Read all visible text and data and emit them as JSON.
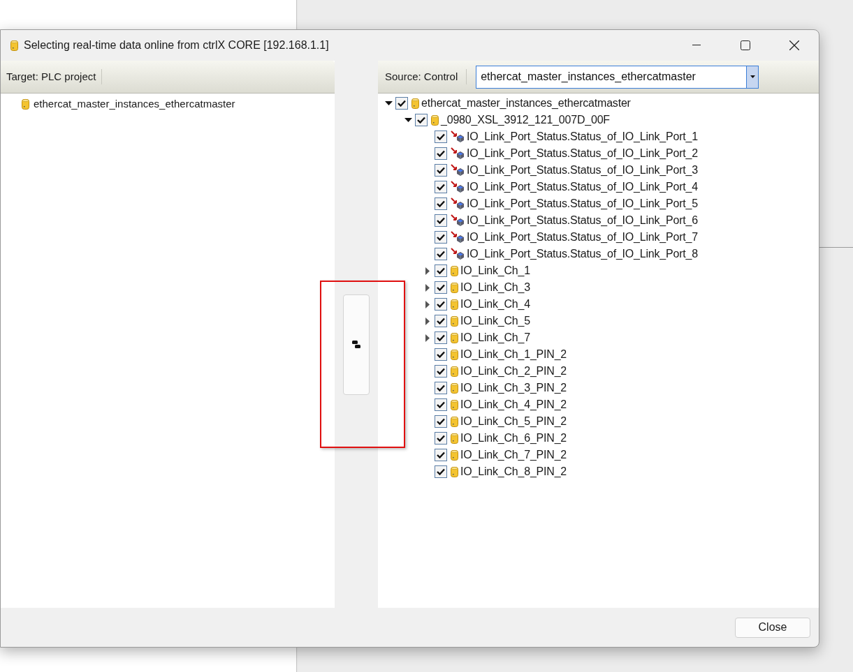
{
  "window": {
    "title": "Selecting real-time data online from ctrlX CORE [192.168.1.1]"
  },
  "target_panel": {
    "header": "Target: PLC project",
    "items": [
      {
        "label": "ethercat_master_instances_ethercatmaster",
        "kind": "db"
      }
    ]
  },
  "source_panel": {
    "header": "Source: Control",
    "dropdown": {
      "value": "ethercat_master_instances_ethercatmaster"
    },
    "tree": [
      {
        "label": "ethercat_master_instances_ethercatmaster",
        "kind": "db",
        "checked": true,
        "expanded": true,
        "children": [
          {
            "label": "_0980_XSL_3912_121_007D_00F",
            "kind": "db",
            "checked": true,
            "expanded": true,
            "children": [
              {
                "label": "IO_Link_Port_Status.Status_of_IO_Link_Port_1",
                "kind": "signal",
                "checked": true
              },
              {
                "label": "IO_Link_Port_Status.Status_of_IO_Link_Port_2",
                "kind": "signal",
                "checked": true
              },
              {
                "label": "IO_Link_Port_Status.Status_of_IO_Link_Port_3",
                "kind": "signal",
                "checked": true
              },
              {
                "label": "IO_Link_Port_Status.Status_of_IO_Link_Port_4",
                "kind": "signal",
                "checked": true
              },
              {
                "label": "IO_Link_Port_Status.Status_of_IO_Link_Port_5",
                "kind": "signal",
                "checked": true
              },
              {
                "label": "IO_Link_Port_Status.Status_of_IO_Link_Port_6",
                "kind": "signal",
                "checked": true
              },
              {
                "label": "IO_Link_Port_Status.Status_of_IO_Link_Port_7",
                "kind": "signal",
                "checked": true
              },
              {
                "label": "IO_Link_Port_Status.Status_of_IO_Link_Port_8",
                "kind": "signal",
                "checked": true
              },
              {
                "label": "IO_Link_Ch_1",
                "kind": "db",
                "checked": true,
                "expanded": false
              },
              {
                "label": "IO_Link_Ch_3",
                "kind": "db",
                "checked": true,
                "expanded": false
              },
              {
                "label": "IO_Link_Ch_4",
                "kind": "db",
                "checked": true,
                "expanded": false
              },
              {
                "label": "IO_Link_Ch_5",
                "kind": "db",
                "checked": true,
                "expanded": false
              },
              {
                "label": "IO_Link_Ch_7",
                "kind": "db",
                "checked": true,
                "expanded": false
              },
              {
                "label": "IO_Link_Ch_1_PIN_2",
                "kind": "db",
                "checked": true
              },
              {
                "label": "IO_Link_Ch_2_PIN_2",
                "kind": "db",
                "checked": true
              },
              {
                "label": "IO_Link_Ch_3_PIN_2",
                "kind": "db",
                "checked": true
              },
              {
                "label": "IO_Link_Ch_4_PIN_2",
                "kind": "db",
                "checked": true
              },
              {
                "label": "IO_Link_Ch_5_PIN_2",
                "kind": "db",
                "checked": true
              },
              {
                "label": "IO_Link_Ch_6_PIN_2",
                "kind": "db",
                "checked": true
              },
              {
                "label": "IO_Link_Ch_7_PIN_2",
                "kind": "db",
                "checked": true
              },
              {
                "label": "IO_Link_Ch_8_PIN_2",
                "kind": "db",
                "checked": true
              }
            ]
          }
        ]
      }
    ]
  },
  "footer": {
    "buttons": [
      "Close"
    ]
  }
}
